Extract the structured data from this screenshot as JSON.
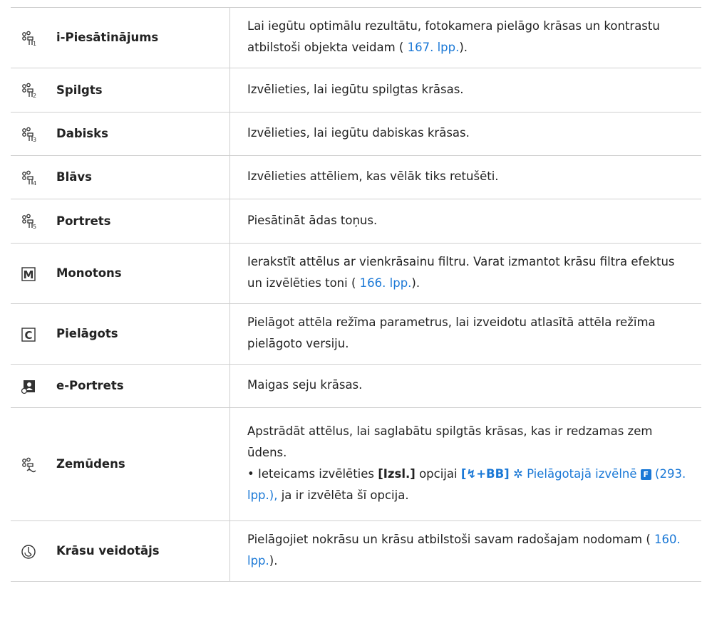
{
  "rows": [
    {
      "icon": "picture-mode-1-icon",
      "name": "i-Piesātinājums",
      "desc_pre": "Lai iegūtu optimālu rezultātu, fotokamera pielāgo krāsas un kontrastu atbilstoši objekta veidam (",
      "desc_link": "167. lpp.",
      "desc_post": ")."
    },
    {
      "icon": "picture-mode-2-icon",
      "name": "Spilgts",
      "desc": "Izvēlieties, lai iegūtu spilgtas krāsas."
    },
    {
      "icon": "picture-mode-3-icon",
      "name": "Dabisks",
      "desc": "Izvēlieties, lai iegūtu dabiskas krāsas."
    },
    {
      "icon": "picture-mode-4-icon",
      "name": "Blāvs",
      "desc": "Izvēlieties attēliem, kas vēlāk tiks retušēti."
    },
    {
      "icon": "picture-mode-5-icon",
      "name": "Portrets",
      "desc": "Piesātināt ādas toņus."
    },
    {
      "icon": "monotone-icon",
      "name": "Monotons",
      "desc_pre": "Ierakstīt attēlus ar vienkrāsainu filtru. Varat izmantot krāsu filtra efektus un izvēlēties toni (",
      "desc_link": "166. lpp.",
      "desc_post": ")."
    },
    {
      "icon": "custom-icon",
      "name": "Pielāgots",
      "desc": "Pielāgot attēla režīma parametrus, lai izveidotu atlasītā attēla režīma pielāgoto versiju."
    },
    {
      "icon": "e-portrait-icon",
      "name": "e-Portrets",
      "desc": "Maigas seju krāsas."
    },
    {
      "icon": "underwater-icon",
      "name": "Zemūdens",
      "desc": "Apstrādāt attēlus, lai saglabātu spilgtās krāsas, kas ir redzamas zem ūdens.",
      "bullet_pre": "Ieteicams izvēlēties ",
      "bullet_opt": "[Izsl.]",
      "bullet_mid": " opcijai ",
      "bullet_flash": "[",
      "bullet_flash_glyph": "↯",
      "bullet_flash_end": "+BB]",
      "bullet_menu": "Pielāgotajā izvēlnē",
      "bullet_flag": "F",
      "bullet_page": "(293. lpp.),",
      "bullet_end": " ja ir izvēlēta šī opcija."
    },
    {
      "icon": "color-creator-icon",
      "name": "Krāsu veidotājs",
      "desc_pre": "Pielāgojiet nokrāsu un krāsu atbilstoši savam radošajam nodomam (",
      "desc_link": "160. lpp.",
      "desc_post": ")."
    }
  ]
}
